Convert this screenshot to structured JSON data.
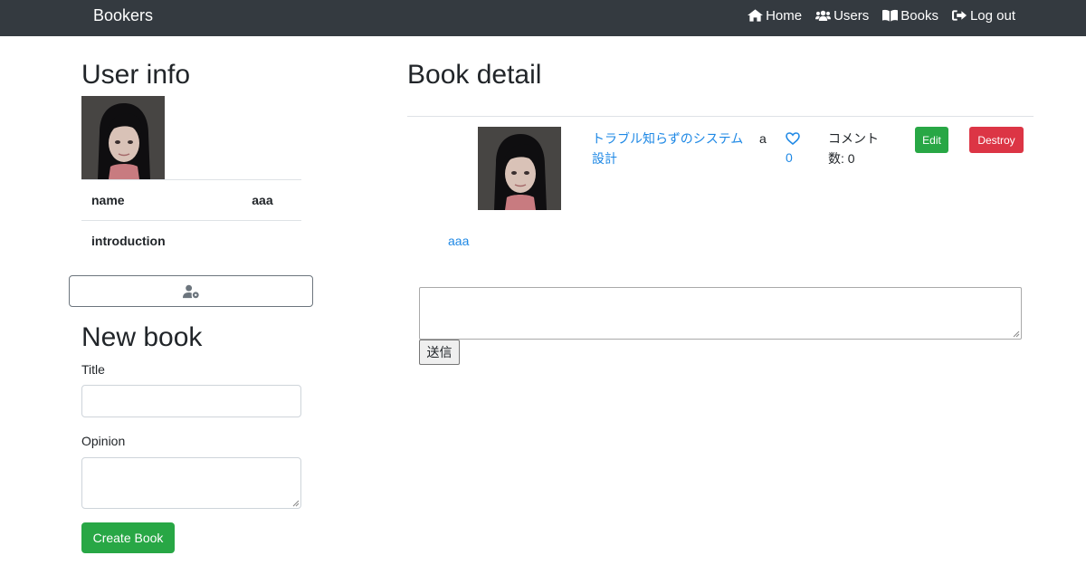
{
  "navbar": {
    "brand": "Bookers",
    "items": [
      {
        "label": "Home",
        "icon": "home-icon"
      },
      {
        "label": "Users",
        "icon": "users-icon"
      },
      {
        "label": "Books",
        "icon": "book-icon"
      },
      {
        "label": "Log out",
        "icon": "sign-out-icon"
      }
    ]
  },
  "user_info": {
    "heading": "User info",
    "rows": [
      {
        "label": "name",
        "value": "aaa"
      },
      {
        "label": "introduction",
        "value": ""
      }
    ],
    "edit_icon": "user-cog-icon"
  },
  "new_book": {
    "heading": "New book",
    "title_label": "Title",
    "title_value": "",
    "opinion_label": "Opinion",
    "opinion_value": "",
    "submit_label": "Create Book"
  },
  "book_detail": {
    "heading": "Book detail",
    "title": "トラブル知らずのシステム設計",
    "body": "a",
    "favorite_count": "0",
    "comment_count": "コメント数: 0",
    "edit_label": "Edit",
    "destroy_label": "Destroy",
    "commenter_name": "aaa",
    "comment_value": "",
    "comment_submit": "送信"
  },
  "colors": {
    "navbar": "#343a40",
    "link": "#1e88e5",
    "success": "#28a745",
    "danger": "#dc3545"
  }
}
